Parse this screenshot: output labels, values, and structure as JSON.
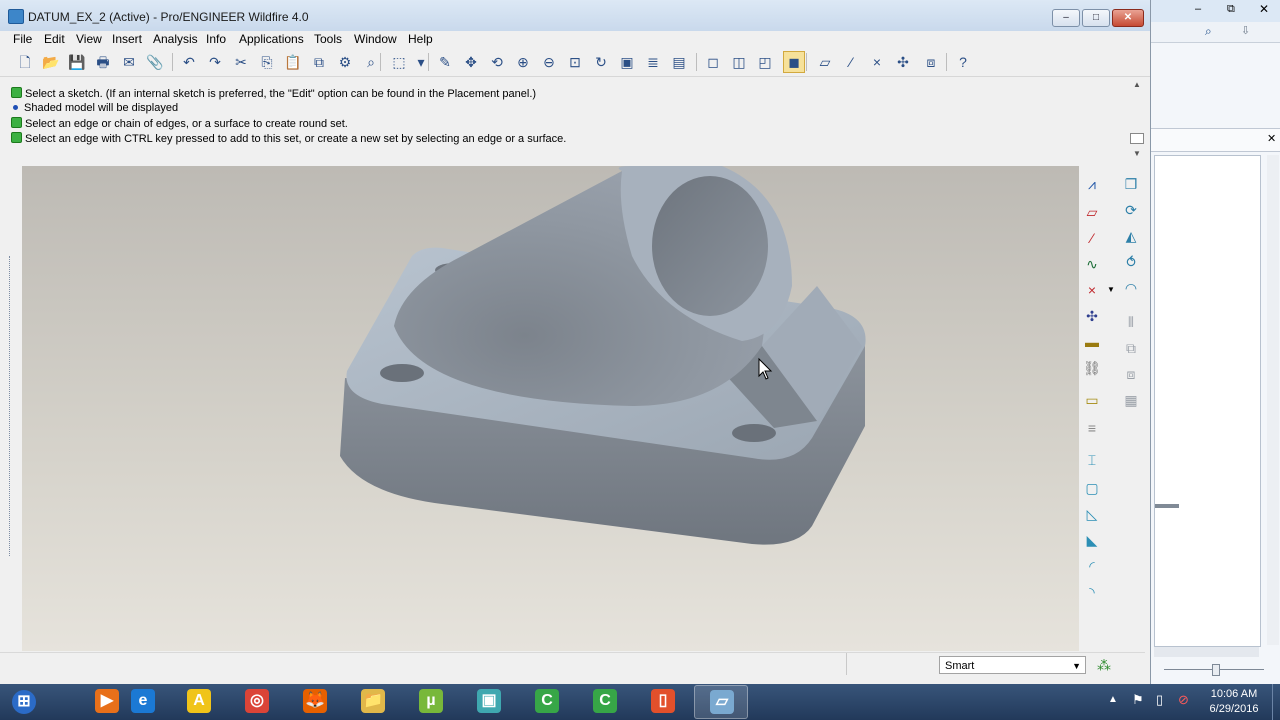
{
  "window": {
    "title": "DATUM_EX_2 (Active) - Pro/ENGINEER Wildfire 4.0"
  },
  "titlebar_buttons": {
    "minimize": "–",
    "maximize": "□",
    "close": "✕"
  },
  "menu": [
    "File",
    "Edit",
    "View",
    "Insert",
    "Analysis",
    "Info",
    "Applications",
    "Tools",
    "Window",
    "Help"
  ],
  "toolbar": {
    "icons": [
      "new-file-icon",
      "open-file-icon",
      "save-icon",
      "print-icon",
      "send-mail-icon",
      "mail-attach-icon",
      "undo-icon",
      "redo-icon",
      "cut-icon",
      "copy-icon",
      "paste-icon",
      "paste-special-icon",
      "regenerate-icon",
      "find-icon",
      "select-box-icon",
      "dropdown-arrow-icon",
      "sketch-tool-icon",
      "spin-center-icon",
      "orient-icon",
      "zoom-in-icon",
      "zoom-out-icon",
      "refit-icon",
      "repaint-icon",
      "view-manager-icon",
      "layers-icon",
      "saved-views-icon",
      "wireframe-icon",
      "hidden-line-icon",
      "no-hidden-icon",
      "shading-icon",
      "datum-plane-icon",
      "datum-axis-icon",
      "datum-point-icon",
      "coordinate-system-icon",
      "datum-display-icon",
      "whats-this-icon"
    ],
    "glyphs": [
      "🗋",
      "📂",
      "💾",
      "🖶",
      "✉",
      "📎",
      "↶",
      "↷",
      "✂",
      "⎘",
      "📋",
      "⧉",
      "⚙",
      "⌕",
      "⬚",
      "▾",
      "✎",
      "✥",
      "⟲",
      "⊕",
      "⊖",
      "⊡",
      "↻",
      "▣",
      "≣",
      "▤",
      "◻",
      "◫",
      "◰",
      "◼",
      "▱",
      "⁄",
      "×",
      "✣",
      "⧈",
      "?"
    ],
    "active_index": 29
  },
  "messages": [
    {
      "icon": "arrow",
      "text": "Select a sketch. (If an internal sketch is preferred, the \"Edit\" option can be found in the Placement panel.)"
    },
    {
      "icon": "dot",
      "text": "Shaded model will be displayed"
    },
    {
      "icon": "arrow",
      "text": "Select an edge or chain of edges, or a surface to create round set."
    },
    {
      "icon": "arrow",
      "text": "Select an edge with CTRL key pressed to add to this set, or create a new set by selecting an edge or a surface."
    }
  ],
  "right_toolbar": {
    "left_col": [
      "datum-plane-icon",
      "sketch-icon",
      "datum-axis-icon",
      "datum-curve-icon",
      "datum-point-icon",
      "coordinate-system-icon",
      "analysis-icon",
      "datum-reference-icon",
      "note-icon",
      "style-icon",
      "hole-icon",
      "shell-icon",
      "rib-icon",
      "draft-icon",
      "round-icon",
      "chamfer-icon"
    ],
    "left_glyphs": [
      "⩘",
      "▱",
      "⁄",
      "∿",
      "×",
      "✣",
      "▬",
      "⛓",
      "▭",
      "≡",
      "⌶",
      "▢",
      "◺",
      "◣",
      "◜",
      "◝"
    ],
    "right_col": [
      "extrude-icon",
      "revolve-icon",
      "sweep-icon",
      "blend-icon",
      "shape-icon",
      "mirror-icon",
      "merge-icon",
      "trim-icon",
      "pattern-icon"
    ],
    "right_glyphs": [
      "❐",
      "⟳",
      "◭",
      "⥀",
      "◠",
      "⫴",
      "⧉",
      "⧈",
      "▦"
    ]
  },
  "status": {
    "filter_value": "Smart"
  },
  "taskbar": {
    "apps": [
      "start-button",
      "media-player-icon",
      "internet-explorer-icon",
      "archicad-icon",
      "chrome-icon",
      "firefox-icon",
      "file-explorer-icon",
      "utorrent-icon",
      "proe-icon",
      "camtasia-icon",
      "camtasia-recorder-icon",
      "office-icon",
      "proengineer-icon"
    ],
    "app_glyphs": [
      "⊞",
      "▶",
      "e",
      "A",
      "◎",
      "🦊",
      "📁",
      "µ",
      "▣",
      "C",
      "C",
      "▯",
      "▱"
    ],
    "app_colors": [
      "#2b6bc7",
      "#e8701a",
      "#1b79d4",
      "#f0c419",
      "#db4437",
      "#e66000",
      "#e0b84a",
      "#78b83a",
      "#3fa8b0",
      "#37a647",
      "#37a647",
      "#e2502b",
      "#7aa9d0"
    ],
    "active_index": 12
  },
  "clock": {
    "time": "10:06 AM",
    "date": "6/29/2016"
  }
}
